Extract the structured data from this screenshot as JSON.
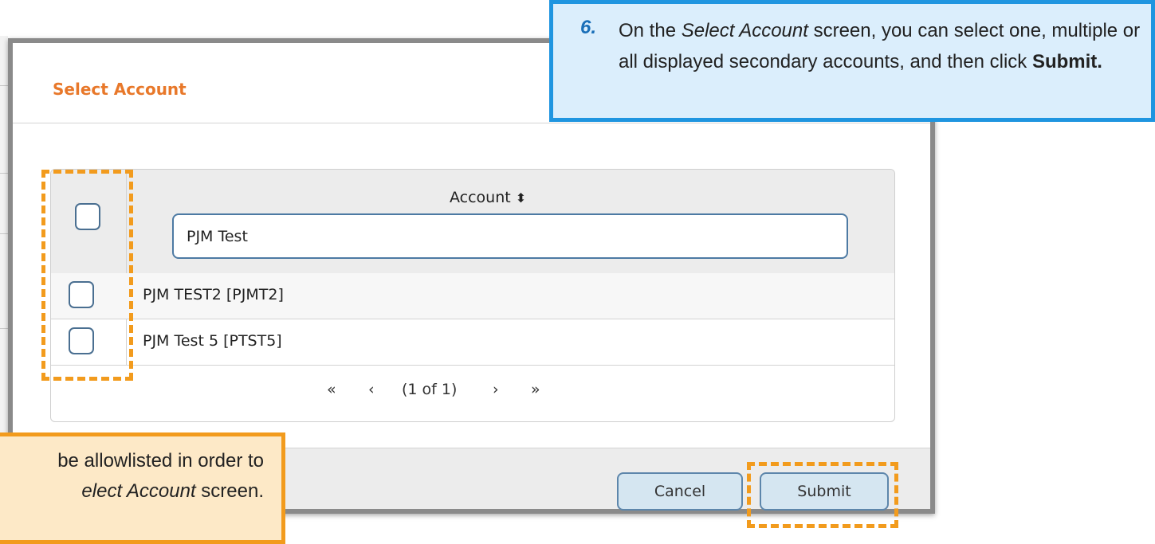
{
  "dialog": {
    "title": "Select Account",
    "table": {
      "column_header": "Account",
      "sort_icon": "sort-icon",
      "filter_value": "PJM Test",
      "rows": [
        {
          "label": "PJM TEST2 [PJMT2]",
          "checked": false
        },
        {
          "label": "PJM Test 5 [PTST5]",
          "checked": false
        }
      ],
      "select_all_checked": false
    },
    "paginator": {
      "first": "«",
      "prev": "‹",
      "status": "(1 of 1)",
      "next": "›",
      "last": "»"
    },
    "buttons": {
      "cancel": "Cancel",
      "submit": "Submit"
    }
  },
  "callout_blue": {
    "step": "6.",
    "text_1": "On the ",
    "text_2": "Select Account",
    "text_3": " screen, you can select one, multiple or all displayed secondary accounts, and then click ",
    "text_4": "Submit."
  },
  "callout_orange": {
    "line1": "be allowlisted in order to",
    "line2_italic": "elect Account",
    "line2_rest": " screen."
  },
  "colors": {
    "title": "#e8782a",
    "highlight": "#f29b1d",
    "callout_blue_border": "#1f95e0",
    "callout_blue_fill": "#dbeefc",
    "callout_orange_fill": "#fde9c7",
    "button_fill": "#d5e6f1",
    "checkbox_border": "#4a6f91"
  }
}
